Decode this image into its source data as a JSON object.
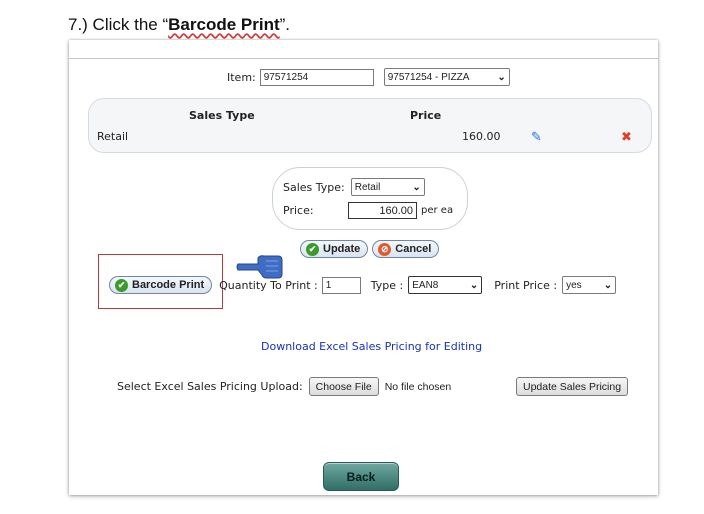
{
  "instruction": {
    "prefix": "7.) Click the “",
    "bold": "Barcode Print",
    "suffix": "”."
  },
  "item": {
    "label": "Item:",
    "value": "97571254",
    "select_value": "97571254 - PIZZA"
  },
  "sales_table": {
    "headers": [
      "Sales Type",
      "Price"
    ],
    "rows": [
      {
        "sales_type": "Retail",
        "price": "160.00"
      }
    ]
  },
  "edit": {
    "sales_type_label": "Sales Type:",
    "sales_type_value": "Retail",
    "price_label": "Price:",
    "price_value": "160.00",
    "unit": "per ea"
  },
  "actions": {
    "update": "Update",
    "cancel": "Cancel"
  },
  "barcode": {
    "button": "Barcode Print",
    "qty_label": "Quantity To Print :",
    "qty_value": "1",
    "type_label": "Type :",
    "type_value": "EAN8",
    "print_price_label": "Print Price :",
    "print_price_value": "yes"
  },
  "download_link": "Download Excel Sales Pricing for Editing",
  "upload": {
    "label": "Select Excel Sales Pricing Upload:",
    "choose": "Choose File",
    "status": "No file chosen",
    "submit": "Update Sales Pricing"
  },
  "back": "Back"
}
